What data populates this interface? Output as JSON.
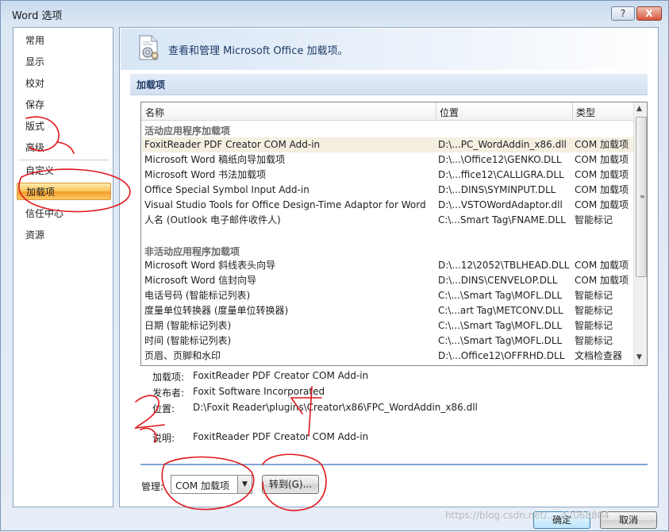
{
  "window": {
    "title": "Word 选项",
    "help_label": "?",
    "close_label": "X"
  },
  "nav": {
    "items": [
      {
        "label": "常用"
      },
      {
        "label": "显示"
      },
      {
        "label": "校对"
      },
      {
        "label": "保存"
      },
      {
        "label": "版式"
      },
      {
        "label": "高级"
      },
      {
        "label": "自定义"
      },
      {
        "label": "加载项",
        "active": true
      },
      {
        "label": "信任中心"
      },
      {
        "label": "资源"
      }
    ]
  },
  "banner": {
    "text": "查看和管理 Microsoft Office 加载项。",
    "icon": "addin-gear-document-icon"
  },
  "section": {
    "title": "加载项"
  },
  "list": {
    "columns": {
      "name": "名称",
      "location": "位置",
      "type": "类型"
    },
    "active_group": {
      "title": "活动应用程序加载项",
      "rows": [
        {
          "name": "FoxitReader PDF Creator COM Add-in",
          "location": "D:\\...PC_WordAddin_x86.dll",
          "type": "COM 加载项"
        },
        {
          "name": "Microsoft Word 稿纸向导加载项",
          "location": "D:\\...\\Office12\\GENKO.DLL",
          "type": "COM 加载项"
        },
        {
          "name": "Microsoft Word 书法加载项",
          "location": "D:\\...ffice12\\CALLIGRA.DLL",
          "type": "COM 加载项"
        },
        {
          "name": "Office Special Symbol Input Add-in",
          "location": "D:\\...DINS\\SYMINPUT.DLL",
          "type": "COM 加载项"
        },
        {
          "name": "Visual Studio Tools for Office Design-Time Adaptor for Word",
          "location": "D:\\...VSTOWordAdaptor.dll",
          "type": "COM 加载项"
        },
        {
          "name": "人名 (Outlook 电子邮件收件人)",
          "location": "C:\\...Smart Tag\\FNAME.DLL",
          "type": "智能标记"
        }
      ]
    },
    "inactive_group": {
      "title": "非活动应用程序加载项",
      "rows": [
        {
          "name": "Microsoft Word 斜线表头向导",
          "location": "D:\\...12\\2052\\TBLHEAD.DLL",
          "type": "COM 加载项"
        },
        {
          "name": "Microsoft Word 信封向导",
          "location": "D:\\...DINS\\CENVELOP.DLL",
          "type": "COM 加载项"
        },
        {
          "name": "电话号码 (智能标记列表)",
          "location": "C:\\...\\Smart Tag\\MOFL.DLL",
          "type": "智能标记"
        },
        {
          "name": "度量单位转换器 (度量单位转换器)",
          "location": "C:\\...art Tag\\METCONV.DLL",
          "type": "智能标记"
        },
        {
          "name": "日期 (智能标记列表)",
          "location": "C:\\...\\Smart Tag\\MOFL.DLL",
          "type": "智能标记"
        },
        {
          "name": "时间 (智能标记列表)",
          "location": "C:\\...\\Smart Tag\\MOFL.DLL",
          "type": "智能标记"
        },
        {
          "name": "页眉、页脚和水印",
          "location": "D:\\...Office12\\OFFRHD.DLL",
          "type": "文档检查器"
        }
      ]
    }
  },
  "details": {
    "addin_label": "加载项:",
    "addin_value": "FoxitReader PDF Creator COM Add-in",
    "publisher_label": "发布者:",
    "publisher_value": "Foxit Software Incorporated",
    "location_label": "位置:",
    "location_value": "D:\\Foxit Reader\\plugins\\Creator\\x86\\FPC_WordAddin_x86.dll",
    "desc_label": "说明:",
    "desc_value": "FoxitReader PDF Creator COM Add-in"
  },
  "manage": {
    "label": "管理:",
    "selected": "COM 加载项",
    "goto_label": "转到(G)..."
  },
  "footer": {
    "ok_label": "确定",
    "cancel_label": "取消"
  },
  "watermark": "https://blog.csdn.net/..._42068804",
  "colors": {
    "active_nav": "#f59b2c",
    "annotation_red": "#e0161b",
    "divider_blue": "#7fa7d9"
  }
}
